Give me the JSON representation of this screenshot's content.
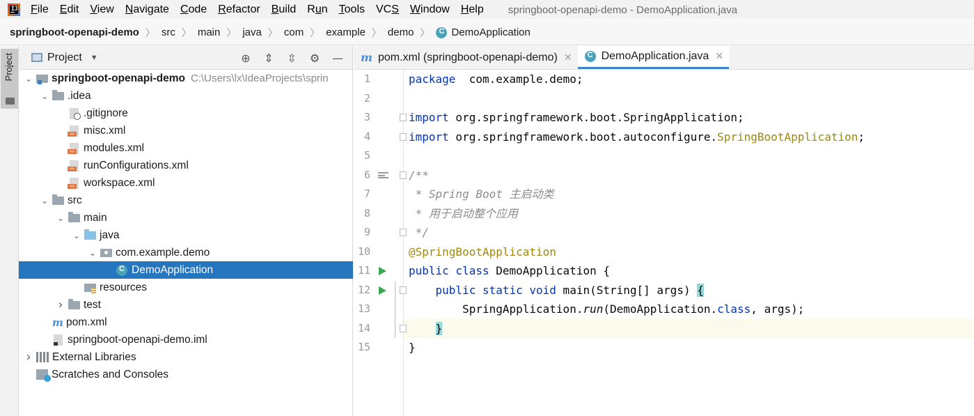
{
  "menubar": {
    "items": [
      {
        "label": "File",
        "mnemonic": "F",
        "rest": "ile"
      },
      {
        "label": "Edit",
        "mnemonic": "E",
        "rest": "dit"
      },
      {
        "label": "View",
        "mnemonic": "V",
        "rest": "iew"
      },
      {
        "label": "Navigate",
        "mnemonic": "N",
        "rest": "avigate"
      },
      {
        "label": "Code",
        "mnemonic": "C",
        "rest": "ode"
      },
      {
        "label": "Refactor",
        "mnemonic": "R",
        "rest": "efactor"
      },
      {
        "label": "Build",
        "mnemonic": "B",
        "rest": "uild"
      },
      {
        "label": "Run",
        "mnemonic": "u",
        "pre": "R",
        "rest": "n"
      },
      {
        "label": "Tools",
        "mnemonic": "T",
        "rest": "ools"
      },
      {
        "label": "VCS",
        "mnemonic": "S",
        "pre": "VC",
        "rest": ""
      },
      {
        "label": "Window",
        "mnemonic": "W",
        "rest": "indow"
      },
      {
        "label": "Help",
        "mnemonic": "H",
        "rest": "elp"
      }
    ],
    "window_title": "springboot-openapi-demo - DemoApplication.java"
  },
  "breadcrumb": [
    "springboot-openapi-demo",
    "src",
    "main",
    "java",
    "com",
    "example",
    "demo",
    "DemoApplication"
  ],
  "tool_strip": {
    "project_tab": "Project"
  },
  "project_panel": {
    "title": "Project",
    "tree": [
      {
        "label": "springboot-openapi-demo",
        "path": "C:\\Users\\lx\\IdeaProjects\\sprin",
        "icon": "module-icon",
        "arrow": "expanded",
        "depth": 0,
        "bold": true
      },
      {
        "label": ".idea",
        "icon": "folder-icon",
        "arrow": "expanded",
        "depth": 1
      },
      {
        "label": ".gitignore",
        "icon": "gitignore-file-icon",
        "arrow": "none",
        "depth": 2
      },
      {
        "label": "misc.xml",
        "icon": "xml-file-icon",
        "arrow": "none",
        "depth": 2
      },
      {
        "label": "modules.xml",
        "icon": "xml-file-icon",
        "arrow": "none",
        "depth": 2
      },
      {
        "label": "runConfigurations.xml",
        "icon": "xml-file-icon",
        "arrow": "none",
        "depth": 2
      },
      {
        "label": "workspace.xml",
        "icon": "xml-file-icon",
        "arrow": "none",
        "depth": 2
      },
      {
        "label": "src",
        "icon": "folder-icon",
        "arrow": "expanded",
        "depth": 1
      },
      {
        "label": "main",
        "icon": "folder-icon",
        "arrow": "expanded",
        "depth": 2
      },
      {
        "label": "java",
        "icon": "source-folder-icon",
        "arrow": "expanded",
        "depth": 3
      },
      {
        "label": "com.example.demo",
        "icon": "package-icon",
        "arrow": "expanded",
        "depth": 4
      },
      {
        "label": "DemoApplication",
        "icon": "class-icon",
        "arrow": "none",
        "depth": 5,
        "selected": true
      },
      {
        "label": "resources",
        "icon": "resources-folder-icon",
        "arrow": "none",
        "depth": 3
      },
      {
        "label": "test",
        "icon": "folder-icon",
        "arrow": "collapsed",
        "depth": 2
      },
      {
        "label": "pom.xml",
        "icon": "maven-icon",
        "arrow": "none",
        "depth": 1
      },
      {
        "label": "springboot-openapi-demo.iml",
        "icon": "iml-file-icon",
        "arrow": "none",
        "depth": 1
      },
      {
        "label": "External Libraries",
        "icon": "libraries-icon",
        "arrow": "collapsed",
        "depth": 0
      },
      {
        "label": "Scratches and Consoles",
        "icon": "scratches-icon",
        "arrow": "none",
        "depth": 0
      }
    ]
  },
  "editor": {
    "tabs": [
      {
        "label": "pom.xml (springboot-openapi-demo)",
        "icon": "maven-icon",
        "active": false
      },
      {
        "label": "DemoApplication.java",
        "icon": "class-icon",
        "active": true
      }
    ],
    "lines": [
      {
        "n": "1",
        "code": [
          [
            "kw",
            "package"
          ],
          [
            "",
            "  com.example.demo;"
          ]
        ]
      },
      {
        "n": "2",
        "code": []
      },
      {
        "n": "3",
        "code": [
          [
            "kw",
            "import"
          ],
          [
            "",
            " org.springframework.boot.SpringApplication;"
          ]
        ],
        "fold": true
      },
      {
        "n": "4",
        "code": [
          [
            "kw",
            "import"
          ],
          [
            "",
            " org.springframework.boot.autoconfigure."
          ],
          [
            "ann",
            "SpringBootApplication"
          ],
          [
            "",
            ";"
          ]
        ],
        "fold": true
      },
      {
        "n": "5",
        "code": []
      },
      {
        "n": "6",
        "code": [
          [
            "cmt",
            "/**"
          ]
        ],
        "fold": true,
        "doc": true
      },
      {
        "n": "7",
        "code": [
          [
            "cmt",
            " * Spring Boot 主启动类"
          ]
        ]
      },
      {
        "n": "8",
        "code": [
          [
            "cmt",
            " * 用于启动整个应用"
          ]
        ]
      },
      {
        "n": "9",
        "code": [
          [
            "cmt",
            " */"
          ]
        ],
        "fold": true
      },
      {
        "n": "10",
        "code": [
          [
            "ann",
            "@SpringBootApplication"
          ]
        ]
      },
      {
        "n": "11",
        "code": [
          [
            "kw",
            "public class"
          ],
          [
            "",
            " DemoApplication {"
          ]
        ],
        "run": true
      },
      {
        "n": "12",
        "code": [
          [
            "",
            "    "
          ],
          [
            "kw",
            "public static void"
          ],
          [
            "",
            " main(String[] args) "
          ],
          [
            "brace",
            "{"
          ]
        ],
        "run": true,
        "fold": true
      },
      {
        "n": "13",
        "code": [
          [
            "",
            "        SpringApplication."
          ],
          [
            "itl",
            "run"
          ],
          [
            "",
            "(DemoApplication."
          ],
          [
            "kw",
            "class"
          ],
          [
            "",
            ", args);"
          ]
        ]
      },
      {
        "n": "14",
        "code": [
          [
            "",
            "    "
          ],
          [
            "brace",
            "}"
          ]
        ],
        "fold": true,
        "current": true
      },
      {
        "n": "15",
        "code": [
          [
            "",
            "}"
          ]
        ]
      }
    ]
  },
  "colors": {
    "accent": "#2675bf",
    "keyword": "#0033b3",
    "annotation": "#9e880d",
    "comment": "#8c8c8c",
    "run": "#3aa655"
  }
}
